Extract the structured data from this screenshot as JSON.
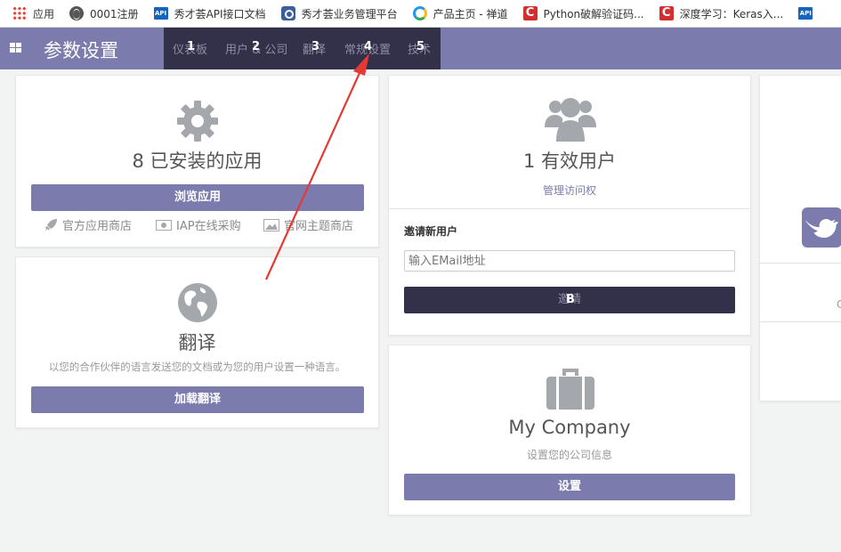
{
  "bookmarks": [
    {
      "label": "应用",
      "icon": "apps-grid-icon"
    },
    {
      "label": "0001注册",
      "icon": "globe-icon"
    },
    {
      "label": "秀才荟API接口文档",
      "icon": "api-icon"
    },
    {
      "label": "秀才荟业务管理平台",
      "icon": "camera-icon"
    },
    {
      "label": "产品主页 - 禅道",
      "icon": "chandao-icon"
    },
    {
      "label": "Python破解验证码...",
      "icon": "csdn-icon"
    },
    {
      "label": "深度学习：Keras入...",
      "icon": "csdn-icon"
    },
    {
      "label": "API",
      "icon": "api-icon"
    }
  ],
  "header": {
    "title": "参数设置",
    "menu": [
      {
        "label": "仪表板",
        "badge": "1"
      },
      {
        "label": "用户 & 公司",
        "badge": "2"
      },
      {
        "label": "翻译",
        "badge": "3"
      },
      {
        "label": "常规设置",
        "badge": "4"
      },
      {
        "label": "技术",
        "badge": "5"
      }
    ]
  },
  "apps_card": {
    "count_text": "8 已安装的应用",
    "browse_button": "浏览应用",
    "links": [
      "官方应用商店",
      "IAP在线采购",
      "官网主题商店"
    ]
  },
  "translate_card": {
    "title": "翻译",
    "description": "以您的合作伙伴的语言发送您的文档或为您的用户设置一种语言。",
    "button": "加载翻译"
  },
  "users_card": {
    "count_text": "1 有效用户",
    "manage_link": "管理访问权",
    "invite_label": "邀请新用户",
    "email_placeholder": "输入EMail地址",
    "invite_button": "邀请",
    "invite_badge": "B"
  },
  "company_card": {
    "title": "My Company",
    "subtitle": "设置您的公司信息",
    "button": "设置"
  },
  "share_card": {
    "partial_letter": "C"
  },
  "colors": {
    "brand": "#7c7bad",
    "dark": "#33304a",
    "annotation_arrow": "#e53935"
  }
}
